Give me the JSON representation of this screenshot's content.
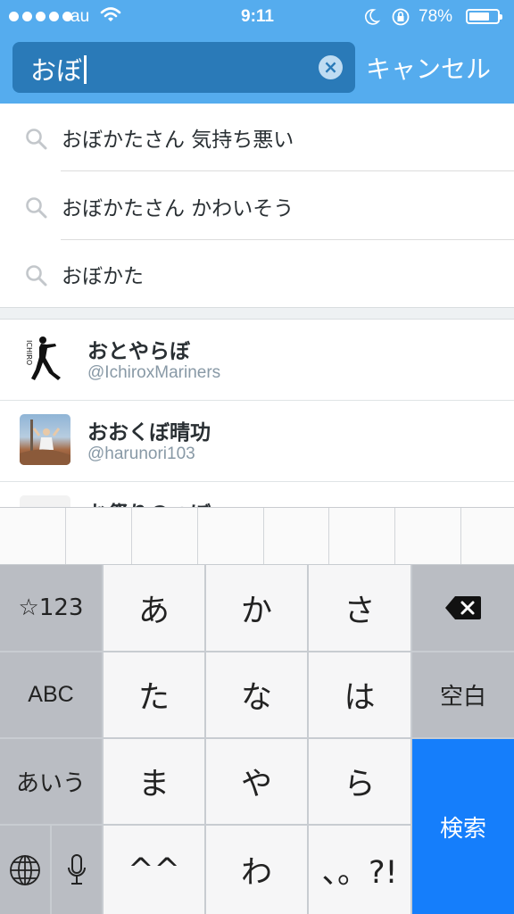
{
  "status_bar": {
    "carrier": "au",
    "time": "9:11",
    "battery": "78%",
    "battery_level": 0.78
  },
  "search": {
    "value": "おぼ",
    "cancel_label": "キャンセル",
    "clear_icon": "clear-icon"
  },
  "suggestions": [
    {
      "text": "おぼかたさん 気持ち悪い"
    },
    {
      "text": "おぼかたさん かわいそう"
    },
    {
      "text": "おぼかた"
    }
  ],
  "users": [
    {
      "name": "おとやらぼ",
      "handle": "@IchiroxMariners",
      "avatar_text": "ICHIRO"
    },
    {
      "name": "おおくぼ晴功",
      "handle": "@harunori103"
    },
    {
      "name": "お祭りのつぼ",
      "handle": ""
    }
  ],
  "keyboard": {
    "mode_123": "☆123",
    "mode_abc": "ABC",
    "mode_kana": "あいう",
    "keys": [
      "あ",
      "か",
      "さ",
      "た",
      "な",
      "は",
      "ま",
      "や",
      "ら",
      "^^",
      "わ",
      "、。?!"
    ],
    "space": "空白",
    "search": "検索",
    "accent": "#157efb"
  },
  "colors": {
    "header": "#55acee",
    "search_field": "#2a7ab8"
  }
}
